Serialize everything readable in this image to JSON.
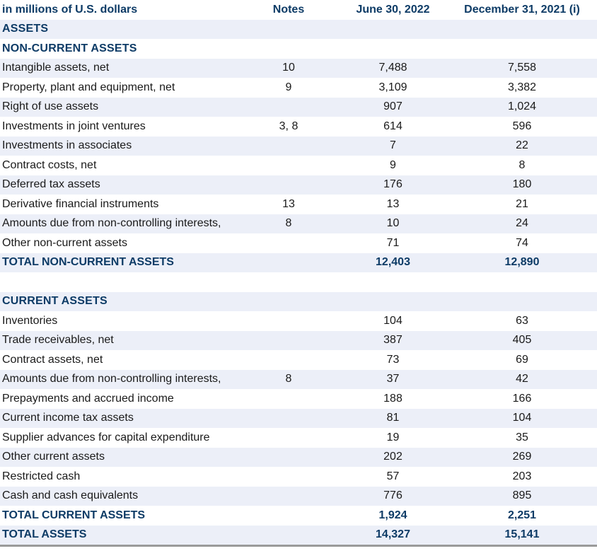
{
  "header": {
    "label": "in millions of U.S. dollars",
    "notes": "Notes",
    "col1": "June 30, 2022",
    "col2": "December 31, 2021 (i)"
  },
  "sections": {
    "assets": "ASSETS",
    "non_current": "NON-CURRENT ASSETS",
    "current": "CURRENT ASSETS"
  },
  "non_current_rows": [
    {
      "label": "Intangible assets, net",
      "notes": "10",
      "v1": "7,488",
      "v2": "7,558"
    },
    {
      "label": "Property, plant and equipment, net",
      "notes": "9",
      "v1": "3,109",
      "v2": "3,382"
    },
    {
      "label": "Right of use assets",
      "notes": "",
      "v1": "907",
      "v2": "1,024"
    },
    {
      "label": "Investments in joint ventures",
      "notes": "3, 8",
      "v1": "614",
      "v2": "596"
    },
    {
      "label": "Investments in associates",
      "notes": "",
      "v1": "7",
      "v2": "22"
    },
    {
      "label": "Contract costs, net",
      "notes": "",
      "v1": "9",
      "v2": "8"
    },
    {
      "label": "Deferred tax assets",
      "notes": "",
      "v1": "176",
      "v2": "180"
    },
    {
      "label": "Derivative financial instruments",
      "notes": "13",
      "v1": "13",
      "v2": "21"
    },
    {
      "label": "Amounts due from non-controlling interests,",
      "notes": "8",
      "v1": "10",
      "v2": "24"
    },
    {
      "label": "Other non-current assets",
      "notes": "",
      "v1": "71",
      "v2": "74"
    }
  ],
  "total_non_current": {
    "label": "TOTAL NON-CURRENT ASSETS",
    "v1": "12,403",
    "v2": "12,890"
  },
  "current_rows": [
    {
      "label": "Inventories",
      "notes": "",
      "v1": "104",
      "v2": "63"
    },
    {
      "label": "Trade receivables, net",
      "notes": "",
      "v1": "387",
      "v2": "405"
    },
    {
      "label": "Contract assets, net",
      "notes": "",
      "v1": "73",
      "v2": "69"
    },
    {
      "label": "Amounts due from non-controlling interests,",
      "notes": "8",
      "v1": "37",
      "v2": "42"
    },
    {
      "label": "Prepayments and accrued income",
      "notes": "",
      "v1": "188",
      "v2": "166"
    },
    {
      "label": "Current income tax assets",
      "notes": "",
      "v1": "81",
      "v2": "104"
    },
    {
      "label": "Supplier advances for capital expenditure",
      "notes": "",
      "v1": "19",
      "v2": "35"
    },
    {
      "label": "Other current assets",
      "notes": "",
      "v1": "202",
      "v2": "269"
    },
    {
      "label": "Restricted cash",
      "notes": "",
      "v1": "57",
      "v2": "203"
    },
    {
      "label": "Cash and cash equivalents",
      "notes": "",
      "v1": "776",
      "v2": "895"
    }
  ],
  "total_current": {
    "label": "TOTAL CURRENT ASSETS",
    "v1": "1,924",
    "v2": "2,251"
  },
  "total_assets": {
    "label": "TOTAL ASSETS",
    "v1": "14,327",
    "v2": "15,141"
  }
}
